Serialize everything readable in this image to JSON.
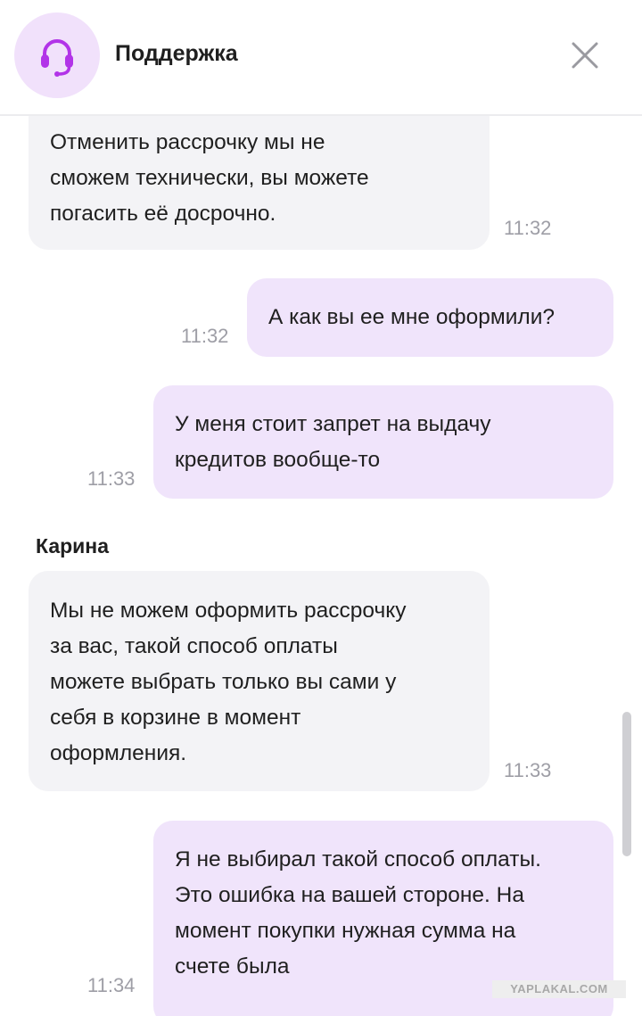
{
  "header": {
    "title": "Поддержка",
    "avatar_icon": "headset-icon",
    "close_icon": "close-icon"
  },
  "colors": {
    "accent": "#b233e8",
    "avatar_bg": "#f1e1fb",
    "incoming_bubble": "#f3f3f6",
    "outgoing_bubble": "#f0e4fb",
    "time_text": "#9e9ea6"
  },
  "messages": [
    {
      "direction": "in",
      "text": "Отменить рассрочку мы не\nсможем технически, вы можете\nпогасить её досрочно.",
      "time": "11:32"
    },
    {
      "direction": "out",
      "text": "А как вы ее мне оформили?",
      "time": "11:32"
    },
    {
      "direction": "out",
      "text": "У меня стоит запрет на выдачу\nкредитов вообще-то",
      "time": "11:33"
    },
    {
      "direction": "in",
      "sender": "Карина",
      "text": "Мы не можем оформить рассрочку\nза вас, такой способ оплаты\nможете выбрать только вы сами у\nсебя в корзине в момент\nоформления.",
      "time": "11:33"
    },
    {
      "direction": "out",
      "text": "Я не выбирал такой способ оплаты.\nЭто ошибка на вашей стороне. На\nмомент покупки нужная сумма на\nсчете была",
      "time": "11:34"
    }
  ],
  "watermark": "YAPLAKAL.COM"
}
